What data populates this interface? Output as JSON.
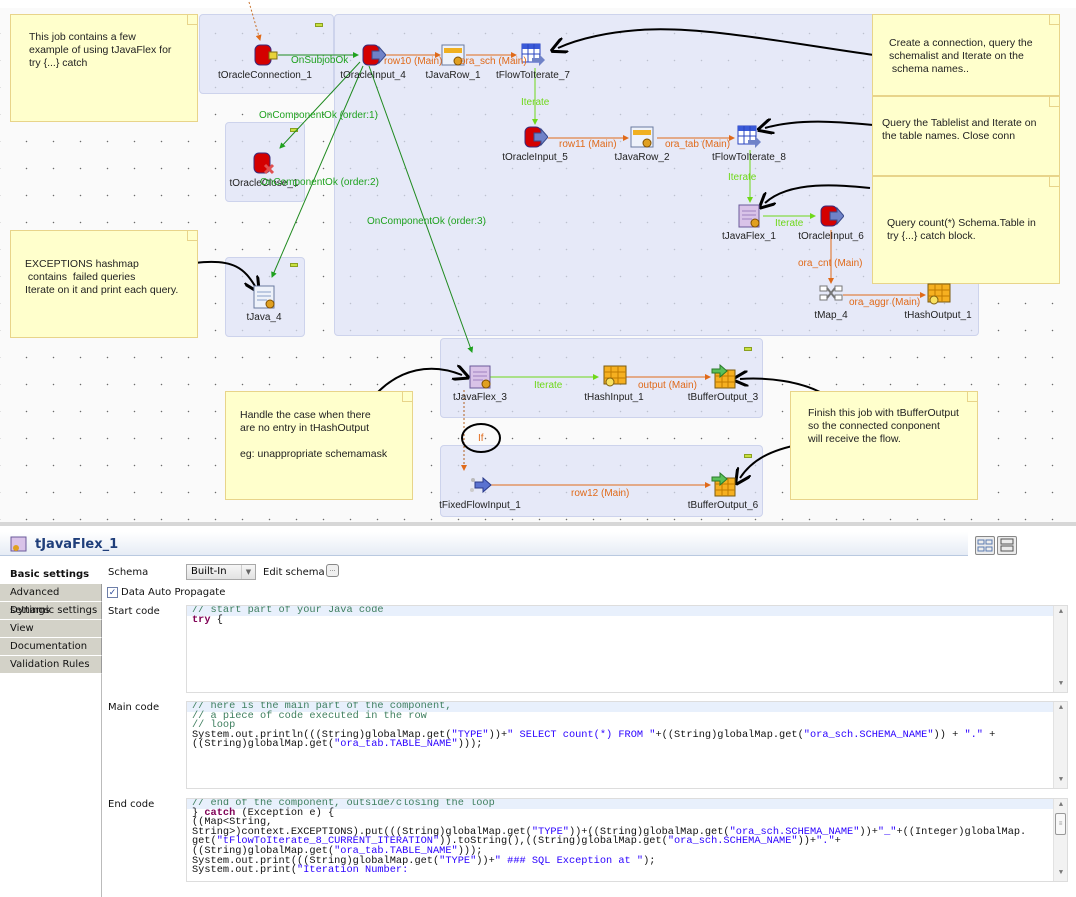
{
  "notes": {
    "intro": "This job contains a few\nexample of using tJavaFlex for\ntry {...} catch",
    "schema": "Create a connection, query the\nschemalist and Iterate on the\n schema names..",
    "table": "Query the Tablelist and Iterate on\nthe table names. Close conn",
    "count": "Query count(*) Schema.Table in\ntry {...} catch block.",
    "exceptions": "EXCEPTIONS hashmap\n contains  failed queries\nIterate on it and print each query.",
    "handle": "Handle the case when there\nare no entry in tHashOutput\n\neg: unappropriate schemamask",
    "finish": "Finish this job with tBufferOutput\nso the connected conponent\nwill receive the flow."
  },
  "components": {
    "oracle_connection_1": "tOracleConnection_1",
    "oracle_input_4": "tOracleInput_4",
    "java_row_1": "tJavaRow_1",
    "flow_to_iterate_7": "tFlowToIterate_7",
    "oracle_input_5": "tOracleInput_5",
    "java_row_2": "tJavaRow_2",
    "flow_to_iterate_8": "tFlowToIterate_8",
    "java_flex_1": "tJavaFlex_1",
    "oracle_input_6": "tOracleInput_6",
    "map_4": "tMap_4",
    "hash_output_1": "tHashOutput_1",
    "oracle_close_1": "tOracleClose_1",
    "java_4": "tJava_4",
    "java_flex_3": "tJavaFlex_3",
    "hash_input_1": "tHashInput_1",
    "buffer_output_3": "tBufferOutput_3",
    "fixed_flow_input_1": "tFixedFlowInput_1",
    "buffer_output_6": "tBufferOutput_6"
  },
  "connections": {
    "on_subjob_ok": "OnSubjobOk",
    "row10": "row10 (Main)",
    "ora_sch": "ora_sch (Main)",
    "iterate_1": "Iterate",
    "row11": "row11 (Main)",
    "ora_tab": "ora_tab (Main)",
    "iterate_2": "Iterate",
    "iterate_3": "Iterate",
    "ora_cnt": "ora_cnt (Main)",
    "ora_aggr": "ora_aggr (Main)",
    "on_component_ok_1": "OnComponentOk (order:1)",
    "on_component_ok_2": "OnComponentOk (order:2)",
    "on_component_ok_3": "OnComponentOk (order:3)",
    "iterate_4": "Iterate",
    "output_main": "output (Main)",
    "if": "If",
    "row12": "row12 (Main)"
  },
  "panel": {
    "title": "tJavaFlex_1",
    "tabs": [
      "Basic settings",
      "Advanced settings",
      "Dynamic settings",
      "View",
      "Documentation",
      "Validation Rules"
    ],
    "active_tab": "Basic settings",
    "schema_label": "Schema",
    "schema_value": "Built-In",
    "edit_schema_label": "Edit schema",
    "edit_schema_button": "...",
    "data_auto_propagate_label": "Data Auto Propagate",
    "data_auto_propagate_checked": true,
    "start_code_label": "Start code",
    "main_code_label": "Main code",
    "end_code_label": "End code",
    "start_code": [
      [
        {
          "t": "cm",
          "v": "// start part of your Java code"
        }
      ],
      [
        {
          "t": "kw",
          "v": "try"
        },
        {
          "t": "",
          "v": " {"
        }
      ]
    ],
    "main_code": [
      [
        {
          "t": "cm",
          "v": "// here is the main part of the component,"
        }
      ],
      [
        {
          "t": "cm",
          "v": "// a piece of code executed in the row"
        }
      ],
      [
        {
          "t": "cm",
          "v": "// loop"
        }
      ],
      [
        {
          "t": "",
          "v": "System.out.println(((String)globalMap.get("
        },
        {
          "t": "st",
          "v": "\"TYPE\""
        },
        {
          "t": "",
          "v": "))+"
        },
        {
          "t": "st",
          "v": "\" SELECT count(*) FROM \""
        },
        {
          "t": "",
          "v": "+((String)globalMap.get("
        },
        {
          "t": "st",
          "v": "\"ora_sch.SCHEMA_NAME\""
        },
        {
          "t": "",
          "v": ")) + "
        },
        {
          "t": "st",
          "v": "\".\""
        },
        {
          "t": "",
          "v": " +"
        }
      ],
      [
        {
          "t": "",
          "v": "((String)globalMap.get("
        },
        {
          "t": "st",
          "v": "\"ora_tab.TABLE_NAME\""
        },
        {
          "t": "",
          "v": ")));"
        }
      ]
    ],
    "end_code": [
      [
        {
          "t": "cm",
          "v": "// end of the component, outside/closing the loop"
        }
      ],
      [
        {
          "t": "",
          "v": "} "
        },
        {
          "t": "kw",
          "v": "catch"
        },
        {
          "t": "",
          "v": " (Exception e) {"
        }
      ],
      [
        {
          "t": "",
          "v": "((Map<String,"
        }
      ],
      [
        {
          "t": "",
          "v": "String>)context.EXCEPTIONS).put(((String)globalMap.get("
        },
        {
          "t": "st",
          "v": "\"TYPE\""
        },
        {
          "t": "",
          "v": "))+((String)globalMap.get("
        },
        {
          "t": "st",
          "v": "\"ora_sch.SCHEMA_NAME\""
        },
        {
          "t": "",
          "v": "))+"
        },
        {
          "t": "st",
          "v": "\"_\""
        },
        {
          "t": "",
          "v": "+((Integer)globalMap."
        }
      ],
      [
        {
          "t": "",
          "v": "get("
        },
        {
          "t": "st",
          "v": "\"tFlowToIterate_8_CURRENT_ITERATION\""
        },
        {
          "t": "",
          "v": ")).toString(),((String)globalMap.get("
        },
        {
          "t": "st",
          "v": "\"ora_sch.SCHEMA_NAME\""
        },
        {
          "t": "",
          "v": "))+"
        },
        {
          "t": "st",
          "v": "\".\""
        },
        {
          "t": "",
          "v": "+"
        }
      ],
      [
        {
          "t": "",
          "v": "((String)globalMap.get("
        },
        {
          "t": "st",
          "v": "\"ora_tab.TABLE_NAME\""
        },
        {
          "t": "",
          "v": ")));"
        }
      ],
      [
        {
          "t": "",
          "v": "System.out.print(((String)globalMap.get("
        },
        {
          "t": "st",
          "v": "\"TYPE\""
        },
        {
          "t": "",
          "v": "))+"
        },
        {
          "t": "st",
          "v": "\" ### SQL Exception at \""
        },
        {
          "t": "",
          "v": ");"
        }
      ],
      [
        {
          "t": "",
          "v": "System.out.print("
        },
        {
          "t": "st",
          "v": "\"Iteration Number:"
        }
      ]
    ]
  }
}
